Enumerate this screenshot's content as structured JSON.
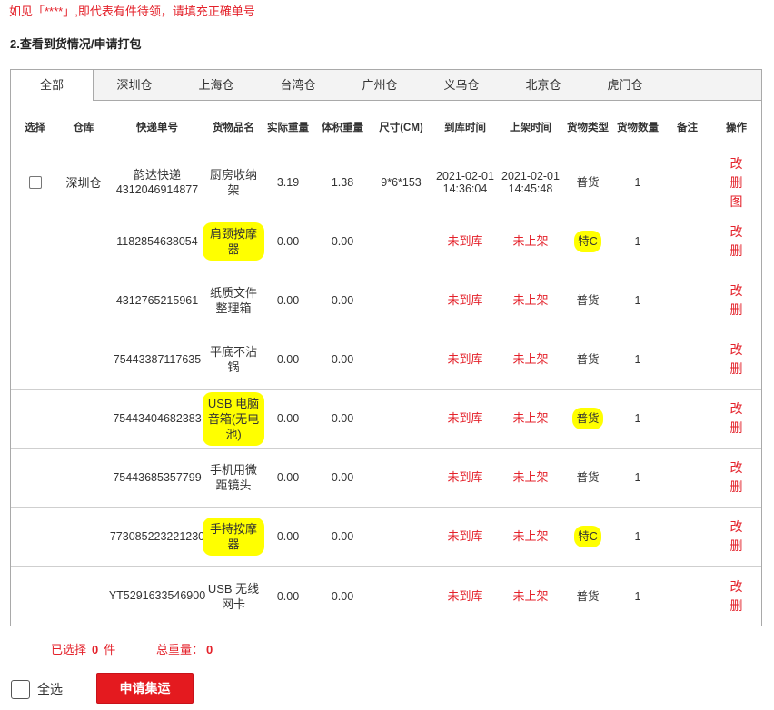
{
  "notice": "如见「****」,即代表有件待领，请填充正確单号",
  "section_title": "2.查看到货情况/申请打包",
  "tabs": [
    {
      "label": "全部",
      "active": true
    },
    {
      "label": "深圳仓"
    },
    {
      "label": "上海仓"
    },
    {
      "label": "台湾仓"
    },
    {
      "label": "广州仓"
    },
    {
      "label": "义乌仓"
    },
    {
      "label": "北京仓"
    },
    {
      "label": "虎门仓"
    }
  ],
  "columns": [
    "选择",
    "仓库",
    "快递单号",
    "货物品名",
    "实际重量",
    "体积重量",
    "尺寸(CM)",
    "到库时间",
    "上架时间",
    "货物类型",
    "货物数量",
    "备注",
    "操作"
  ],
  "rows": [
    {
      "has_checkbox": true,
      "checked": false,
      "warehouse": "深圳仓",
      "courier": "韵达快递",
      "tracking": "4312046914877",
      "name": "厨房收纳架",
      "actual_weight": "3.19",
      "volume_weight": "1.38",
      "size": "9*6*153",
      "arrival_time": "2021-02-01 14:36:04",
      "shelf_time": "2021-02-01 14:45:48",
      "type": "普货",
      "quantity": "1",
      "actions": [
        "改",
        "删",
        "图"
      ]
    },
    {
      "tracking": "1182854638054",
      "name": "肩颈按摩器",
      "actual_weight": "0.00",
      "volume_weight": "0.00",
      "arrival_time": "未到库",
      "shelf_time": "未上架",
      "type": "特C",
      "quantity": "1",
      "actions": [
        "改",
        "删"
      ],
      "highlight": [
        "name",
        "type"
      ]
    },
    {
      "tracking": "4312765215961",
      "name": "纸质文件整理箱",
      "actual_weight": "0.00",
      "volume_weight": "0.00",
      "arrival_time": "未到库",
      "shelf_time": "未上架",
      "type": "普货",
      "quantity": "1",
      "actions": [
        "改",
        "删"
      ]
    },
    {
      "tracking": "75443387117635",
      "name": "平底不沾锅",
      "actual_weight": "0.00",
      "volume_weight": "0.00",
      "arrival_time": "未到库",
      "shelf_time": "未上架",
      "type": "普货",
      "quantity": "1",
      "actions": [
        "改",
        "删"
      ]
    },
    {
      "tracking": "75443404682383",
      "name": "USB 电脑音箱(无电池)",
      "actual_weight": "0.00",
      "volume_weight": "0.00",
      "arrival_time": "未到库",
      "shelf_time": "未上架",
      "type": "普货",
      "quantity": "1",
      "actions": [
        "改",
        "删"
      ],
      "highlight": [
        "name",
        "type"
      ]
    },
    {
      "tracking": "75443685357799",
      "name": "手机用微距镜头",
      "actual_weight": "0.00",
      "volume_weight": "0.00",
      "arrival_time": "未到库",
      "shelf_time": "未上架",
      "type": "普货",
      "quantity": "1",
      "actions": [
        "改",
        "删"
      ]
    },
    {
      "tracking": "773085223221230",
      "name": "手持按摩器",
      "actual_weight": "0.00",
      "volume_weight": "0.00",
      "arrival_time": "未到库",
      "shelf_time": "未上架",
      "type": "特C",
      "quantity": "1",
      "actions": [
        "改",
        "删"
      ],
      "highlight": [
        "name",
        "type"
      ]
    },
    {
      "tracking": "YT5291633546900",
      "name": "USB 无线网卡",
      "actual_weight": "0.00",
      "volume_weight": "0.00",
      "arrival_time": "未到库",
      "shelf_time": "未上架",
      "type": "普货",
      "quantity": "1",
      "actions": [
        "改",
        "删"
      ]
    }
  ],
  "footer": {
    "selected_label": "已选择",
    "selected_count": "0",
    "selected_unit": "件",
    "weight_label": "总重量：",
    "weight_value": "0",
    "select_all_label": "全选",
    "select_all_checked": false,
    "submit_label": "申请集运"
  },
  "colors": {
    "red": "#e4222b",
    "button": "#e41a1f",
    "highlight": "#ffff00"
  }
}
